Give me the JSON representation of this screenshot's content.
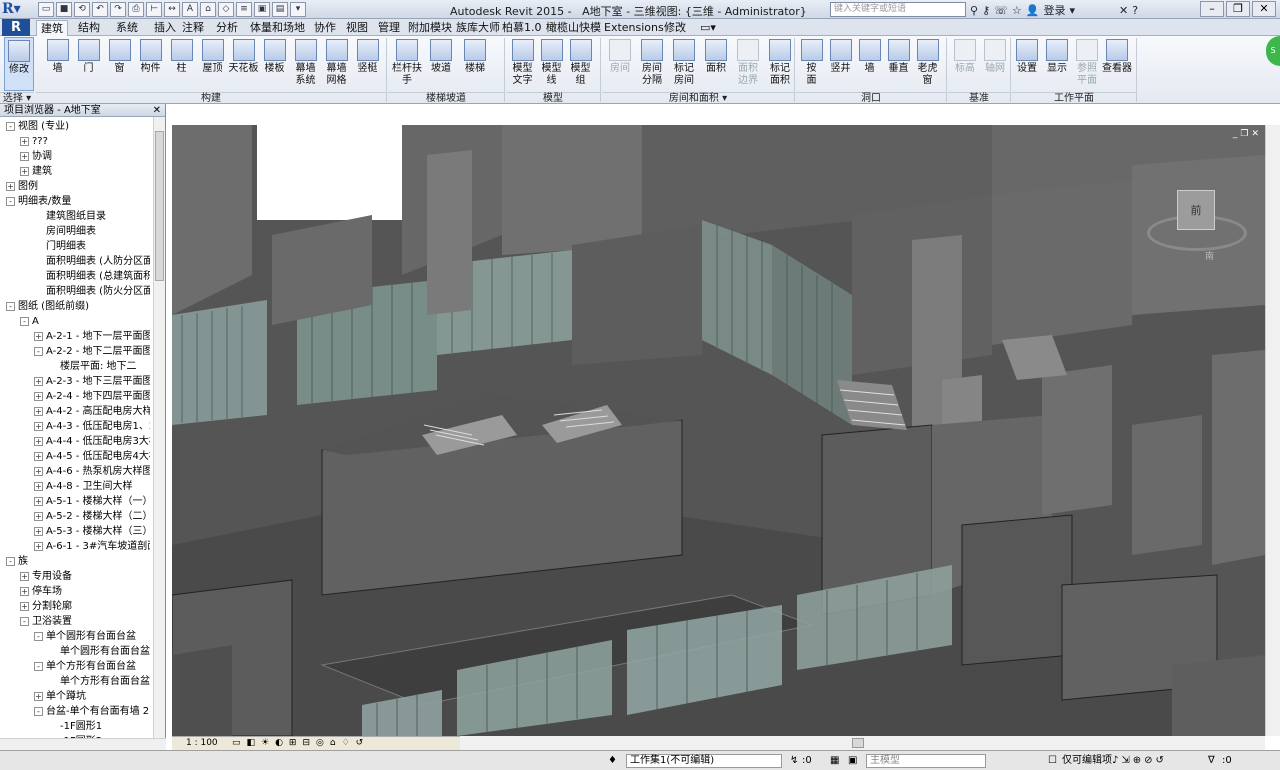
{
  "title": {
    "app": "Autodesk Revit 2015 -",
    "view": "A地下室 - 三维视图: {三维 - Administrator}"
  },
  "search": {
    "placeholder": "键入关键字或短语"
  },
  "signin": "登录",
  "tabs": [
    "建筑",
    "结构",
    "系统",
    "插入",
    "注释",
    "分析",
    "体量和场地",
    "协作",
    "视图",
    "管理",
    "附加模块",
    "族库大师",
    "柏慕1.0",
    "橄榄山快模",
    "Extensions",
    "修改"
  ],
  "ribbon": {
    "modify": "修改",
    "build": [
      {
        "label": "墙",
        "icon": "wall-icon"
      },
      {
        "label": "门",
        "icon": "door-icon"
      },
      {
        "label": "窗",
        "icon": "window-icon"
      },
      {
        "label": "构件",
        "icon": "component-icon"
      },
      {
        "label": "柱",
        "icon": "column-icon"
      },
      {
        "label": "屋顶",
        "icon": "roof-icon"
      },
      {
        "label": "天花板",
        "icon": "ceiling-icon"
      },
      {
        "label": "楼板",
        "icon": "floor-icon"
      },
      {
        "label": "幕墙\n系统",
        "icon": "curtain-system-icon"
      },
      {
        "label": "幕墙\n网格",
        "icon": "curtain-grid-icon"
      },
      {
        "label": "竖梃",
        "icon": "mullion-icon"
      }
    ],
    "stairs": [
      {
        "label": "栏杆扶手",
        "icon": "railing-icon"
      },
      {
        "label": "坡道",
        "icon": "ramp-icon"
      },
      {
        "label": "楼梯",
        "icon": "stair-icon"
      }
    ],
    "model": [
      {
        "label": "模型\n文字",
        "icon": "model-text-icon"
      },
      {
        "label": "模型\n线",
        "icon": "model-line-icon"
      },
      {
        "label": "模型\n组",
        "icon": "model-group-icon"
      }
    ],
    "room": [
      {
        "label": "房间",
        "icon": "room-icon",
        "disabled": true
      },
      {
        "label": "房间\n分隔",
        "icon": "room-separator-icon"
      },
      {
        "label": "标记\n房间",
        "icon": "tag-room-icon"
      },
      {
        "label": "面积",
        "icon": "area-icon"
      },
      {
        "label": "面积\n边界",
        "icon": "area-boundary-icon",
        "disabled": true
      },
      {
        "label": "标记\n面积",
        "icon": "tag-area-icon"
      }
    ],
    "opening": [
      {
        "label": "按\n面",
        "icon": "by-face-icon"
      },
      {
        "label": "竖井",
        "icon": "shaft-icon"
      },
      {
        "label": "墙",
        "icon": "wall-opening-icon"
      },
      {
        "label": "垂直",
        "icon": "vertical-icon"
      },
      {
        "label": "老虎窗",
        "icon": "dormer-icon"
      }
    ],
    "datum": [
      {
        "label": "标高",
        "icon": "level-icon",
        "disabled": true
      },
      {
        "label": "轴网",
        "icon": "grid-icon",
        "disabled": true
      }
    ],
    "workplane": [
      {
        "label": "设置",
        "icon": "set-icon"
      },
      {
        "label": "显示",
        "icon": "show-icon"
      },
      {
        "label": "参照\n平面",
        "icon": "ref-plane-icon",
        "disabled": true
      },
      {
        "label": "查看器",
        "icon": "viewer-icon"
      }
    ],
    "panels": [
      "构建",
      "楼梯坡道",
      "模型",
      "房间和面积 ▾",
      "洞口",
      "基准",
      "工作平面"
    ],
    "select_label": "选择 ▾"
  },
  "browser": {
    "title": "项目浏览器 - A地下室",
    "items": [
      {
        "t": "视图 (专业)",
        "lv": 0,
        "exp": "-"
      },
      {
        "t": "???",
        "lv": 1,
        "exp": "+"
      },
      {
        "t": "协调",
        "lv": 1,
        "exp": "+"
      },
      {
        "t": "建筑",
        "lv": 1,
        "exp": "+"
      },
      {
        "t": "图例",
        "lv": 0,
        "exp": "+"
      },
      {
        "t": "明细表/数量",
        "lv": 0,
        "exp": "-"
      },
      {
        "t": "建筑图纸目录",
        "lv": 2,
        "exp": ""
      },
      {
        "t": "房间明细表",
        "lv": 2,
        "exp": ""
      },
      {
        "t": "门明细表",
        "lv": 2,
        "exp": ""
      },
      {
        "t": "面积明细表 (人防分区面积",
        "lv": 2,
        "exp": ""
      },
      {
        "t": "面积明细表 (总建筑面积)",
        "lv": 2,
        "exp": ""
      },
      {
        "t": "面积明细表 (防火分区面积",
        "lv": 2,
        "exp": ""
      },
      {
        "t": "图纸 (图纸前缀)",
        "lv": 0,
        "exp": "-"
      },
      {
        "t": "A",
        "lv": 1,
        "exp": "-"
      },
      {
        "t": "A-2-1 - 地下一层平面图",
        "lv": 2,
        "exp": "+"
      },
      {
        "t": "A-2-2 - 地下二层平面图",
        "lv": 2,
        "exp": "-"
      },
      {
        "t": "楼层平面: 地下二",
        "lv": 3,
        "exp": ""
      },
      {
        "t": "A-2-3 - 地下三层平面图",
        "lv": 2,
        "exp": "+"
      },
      {
        "t": "A-2-4 - 地下四层平面图",
        "lv": 2,
        "exp": "+"
      },
      {
        "t": "A-4-2 - 高压配电房大样",
        "lv": 2,
        "exp": "+"
      },
      {
        "t": "A-4-3 - 低压配电房1、2",
        "lv": 2,
        "exp": "+"
      },
      {
        "t": "A-4-4 - 低压配电房3大样",
        "lv": 2,
        "exp": "+"
      },
      {
        "t": "A-4-5 - 低压配电房4大样",
        "lv": 2,
        "exp": "+"
      },
      {
        "t": "A-4-6 - 热泵机房大样图",
        "lv": 2,
        "exp": "+"
      },
      {
        "t": "A-4-8 - 卫生间大样",
        "lv": 2,
        "exp": "+"
      },
      {
        "t": "A-5-1 - 楼梯大样（一）",
        "lv": 2,
        "exp": "+"
      },
      {
        "t": "A-5-2 - 楼梯大样（二）",
        "lv": 2,
        "exp": "+"
      },
      {
        "t": "A-5-3 - 楼梯大样（三）",
        "lv": 2,
        "exp": "+"
      },
      {
        "t": "A-6-1 - 3#汽车坡道剖面",
        "lv": 2,
        "exp": "+"
      },
      {
        "t": "族",
        "lv": 0,
        "exp": "-"
      },
      {
        "t": "专用设备",
        "lv": 1,
        "exp": "+"
      },
      {
        "t": "停车场",
        "lv": 1,
        "exp": "+"
      },
      {
        "t": "分割轮廓",
        "lv": 1,
        "exp": "+"
      },
      {
        "t": "卫浴装置",
        "lv": 1,
        "exp": "-"
      },
      {
        "t": "单个圆形有台面台盆",
        "lv": 2,
        "exp": "-"
      },
      {
        "t": "单个圆形有台面台盆",
        "lv": 3,
        "exp": ""
      },
      {
        "t": "单个方形有台面台盆",
        "lv": 2,
        "exp": "-"
      },
      {
        "t": "单个方形有台面台盆",
        "lv": 3,
        "exp": ""
      },
      {
        "t": "单个蹲坑",
        "lv": 2,
        "exp": "+"
      },
      {
        "t": "台盆-单个有台面有墙 2F",
        "lv": 2,
        "exp": "-"
      },
      {
        "t": "-1F圆形1",
        "lv": 3,
        "exp": ""
      },
      {
        "t": "-1F圆形2",
        "lv": 3,
        "exp": ""
      }
    ]
  },
  "viewbar": {
    "scale": "1 : 100"
  },
  "viewcube": {
    "face": "前",
    "compass": "南"
  },
  "status": {
    "workset": "工作集1(不可编辑)",
    "count": ":0",
    "model": "主模型",
    "editable_only": "仅可编辑项",
    "filter_count": ":0"
  }
}
